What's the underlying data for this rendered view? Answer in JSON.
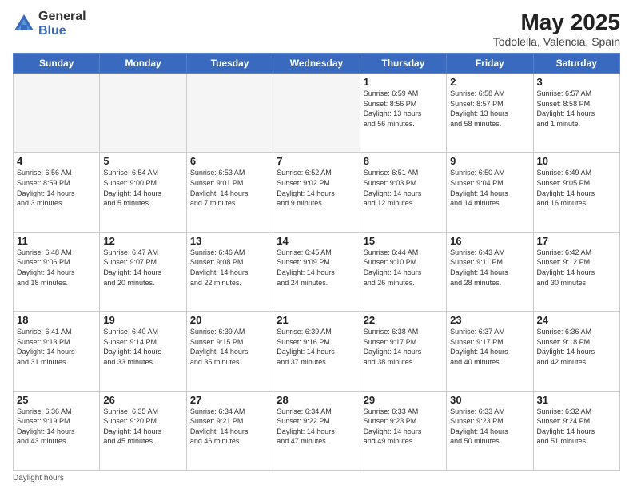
{
  "logo": {
    "general": "General",
    "blue": "Blue"
  },
  "title": "May 2025",
  "subtitle": "Todolella, Valencia, Spain",
  "days_of_week": [
    "Sunday",
    "Monday",
    "Tuesday",
    "Wednesday",
    "Thursday",
    "Friday",
    "Saturday"
  ],
  "footer": "Daylight hours",
  "weeks": [
    [
      {
        "day": "",
        "info": ""
      },
      {
        "day": "",
        "info": ""
      },
      {
        "day": "",
        "info": ""
      },
      {
        "day": "",
        "info": ""
      },
      {
        "day": "1",
        "info": "Sunrise: 6:59 AM\nSunset: 8:56 PM\nDaylight: 13 hours\nand 56 minutes."
      },
      {
        "day": "2",
        "info": "Sunrise: 6:58 AM\nSunset: 8:57 PM\nDaylight: 13 hours\nand 58 minutes."
      },
      {
        "day": "3",
        "info": "Sunrise: 6:57 AM\nSunset: 8:58 PM\nDaylight: 14 hours\nand 1 minute."
      }
    ],
    [
      {
        "day": "4",
        "info": "Sunrise: 6:56 AM\nSunset: 8:59 PM\nDaylight: 14 hours\nand 3 minutes."
      },
      {
        "day": "5",
        "info": "Sunrise: 6:54 AM\nSunset: 9:00 PM\nDaylight: 14 hours\nand 5 minutes."
      },
      {
        "day": "6",
        "info": "Sunrise: 6:53 AM\nSunset: 9:01 PM\nDaylight: 14 hours\nand 7 minutes."
      },
      {
        "day": "7",
        "info": "Sunrise: 6:52 AM\nSunset: 9:02 PM\nDaylight: 14 hours\nand 9 minutes."
      },
      {
        "day": "8",
        "info": "Sunrise: 6:51 AM\nSunset: 9:03 PM\nDaylight: 14 hours\nand 12 minutes."
      },
      {
        "day": "9",
        "info": "Sunrise: 6:50 AM\nSunset: 9:04 PM\nDaylight: 14 hours\nand 14 minutes."
      },
      {
        "day": "10",
        "info": "Sunrise: 6:49 AM\nSunset: 9:05 PM\nDaylight: 14 hours\nand 16 minutes."
      }
    ],
    [
      {
        "day": "11",
        "info": "Sunrise: 6:48 AM\nSunset: 9:06 PM\nDaylight: 14 hours\nand 18 minutes."
      },
      {
        "day": "12",
        "info": "Sunrise: 6:47 AM\nSunset: 9:07 PM\nDaylight: 14 hours\nand 20 minutes."
      },
      {
        "day": "13",
        "info": "Sunrise: 6:46 AM\nSunset: 9:08 PM\nDaylight: 14 hours\nand 22 minutes."
      },
      {
        "day": "14",
        "info": "Sunrise: 6:45 AM\nSunset: 9:09 PM\nDaylight: 14 hours\nand 24 minutes."
      },
      {
        "day": "15",
        "info": "Sunrise: 6:44 AM\nSunset: 9:10 PM\nDaylight: 14 hours\nand 26 minutes."
      },
      {
        "day": "16",
        "info": "Sunrise: 6:43 AM\nSunset: 9:11 PM\nDaylight: 14 hours\nand 28 minutes."
      },
      {
        "day": "17",
        "info": "Sunrise: 6:42 AM\nSunset: 9:12 PM\nDaylight: 14 hours\nand 30 minutes."
      }
    ],
    [
      {
        "day": "18",
        "info": "Sunrise: 6:41 AM\nSunset: 9:13 PM\nDaylight: 14 hours\nand 31 minutes."
      },
      {
        "day": "19",
        "info": "Sunrise: 6:40 AM\nSunset: 9:14 PM\nDaylight: 14 hours\nand 33 minutes."
      },
      {
        "day": "20",
        "info": "Sunrise: 6:39 AM\nSunset: 9:15 PM\nDaylight: 14 hours\nand 35 minutes."
      },
      {
        "day": "21",
        "info": "Sunrise: 6:39 AM\nSunset: 9:16 PM\nDaylight: 14 hours\nand 37 minutes."
      },
      {
        "day": "22",
        "info": "Sunrise: 6:38 AM\nSunset: 9:17 PM\nDaylight: 14 hours\nand 38 minutes."
      },
      {
        "day": "23",
        "info": "Sunrise: 6:37 AM\nSunset: 9:17 PM\nDaylight: 14 hours\nand 40 minutes."
      },
      {
        "day": "24",
        "info": "Sunrise: 6:36 AM\nSunset: 9:18 PM\nDaylight: 14 hours\nand 42 minutes."
      }
    ],
    [
      {
        "day": "25",
        "info": "Sunrise: 6:36 AM\nSunset: 9:19 PM\nDaylight: 14 hours\nand 43 minutes."
      },
      {
        "day": "26",
        "info": "Sunrise: 6:35 AM\nSunset: 9:20 PM\nDaylight: 14 hours\nand 45 minutes."
      },
      {
        "day": "27",
        "info": "Sunrise: 6:34 AM\nSunset: 9:21 PM\nDaylight: 14 hours\nand 46 minutes."
      },
      {
        "day": "28",
        "info": "Sunrise: 6:34 AM\nSunset: 9:22 PM\nDaylight: 14 hours\nand 47 minutes."
      },
      {
        "day": "29",
        "info": "Sunrise: 6:33 AM\nSunset: 9:23 PM\nDaylight: 14 hours\nand 49 minutes."
      },
      {
        "day": "30",
        "info": "Sunrise: 6:33 AM\nSunset: 9:23 PM\nDaylight: 14 hours\nand 50 minutes."
      },
      {
        "day": "31",
        "info": "Sunrise: 6:32 AM\nSunset: 9:24 PM\nDaylight: 14 hours\nand 51 minutes."
      }
    ]
  ]
}
